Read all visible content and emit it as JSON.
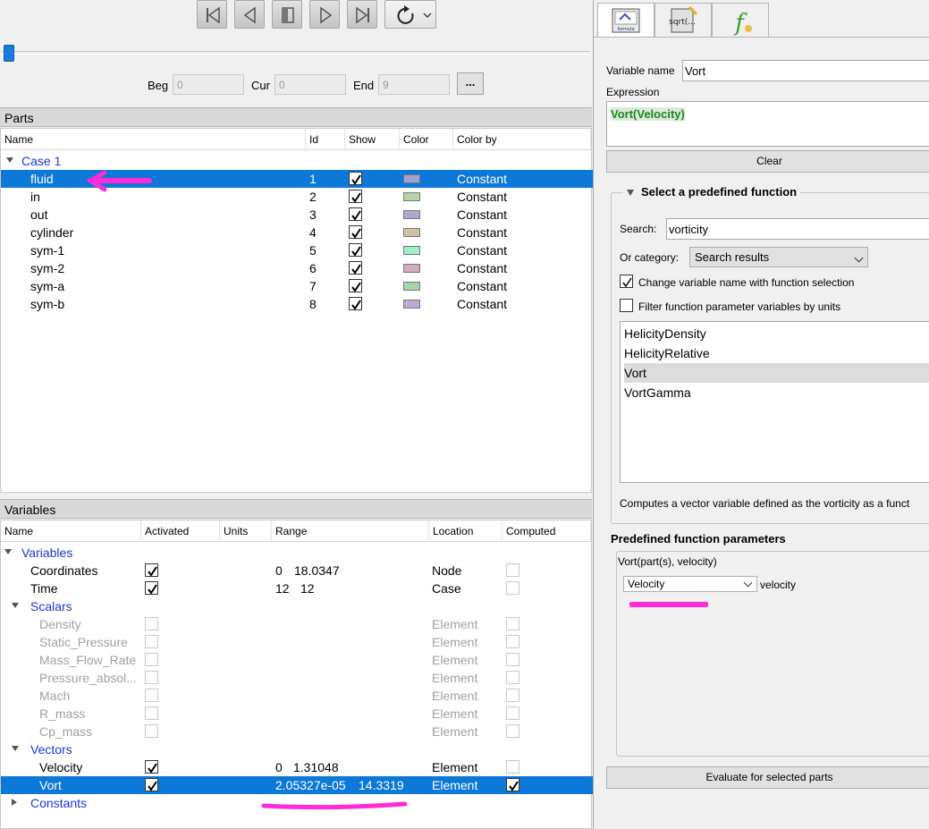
{
  "toolbar": {
    "buttons": [
      {
        "icon": "skip-to-start-icon"
      },
      {
        "icon": "step-back-icon"
      },
      {
        "icon": "stop-icon"
      },
      {
        "icon": "play-icon"
      },
      {
        "icon": "skip-to-end-icon"
      },
      {
        "icon": "loop-icon"
      }
    ],
    "beg_label": "Beg",
    "beg_value": "0",
    "cur_label": "Cur",
    "cur_value": "0",
    "end_label": "End",
    "end_value": "9",
    "more_label": "..."
  },
  "parts": {
    "title": "Parts",
    "columns": [
      "Name",
      "Id",
      "Show",
      "Color",
      "Color by"
    ],
    "case_label": "Case 1",
    "rows": [
      {
        "name": "fluid",
        "id": "1",
        "color": "#9ea2cc",
        "color_by": "Constant"
      },
      {
        "name": "in",
        "id": "2",
        "color": "#b8d2a8",
        "color_by": "Constant"
      },
      {
        "name": "out",
        "id": "3",
        "color": "#a9aace",
        "color_by": "Constant"
      },
      {
        "name": "cylinder",
        "id": "4",
        "color": "#cfc1a6",
        "color_by": "Constant"
      },
      {
        "name": "sym-1",
        "id": "5",
        "color": "#9cf0c4",
        "color_by": "Constant"
      },
      {
        "name": "sym-2",
        "id": "6",
        "color": "#d2acbe",
        "color_by": "Constant"
      },
      {
        "name": "sym-a",
        "id": "7",
        "color": "#a6d2ac",
        "color_by": "Constant"
      },
      {
        "name": "sym-b",
        "id": "8",
        "color": "#bcaad2",
        "color_by": "Constant"
      }
    ]
  },
  "variables": {
    "title": "Variables",
    "columns": [
      "Name",
      "Activated",
      "Units",
      "Range",
      "Location",
      "Computed"
    ],
    "group_variables": "Variables",
    "coordinates": {
      "name": "Coordinates",
      "range_min": "0",
      "range_max": "18.0347",
      "location": "Node"
    },
    "time": {
      "name": "Time",
      "range_min": "12",
      "range_max": "12",
      "location": "Case"
    },
    "group_scalars": "Scalars",
    "scalars": [
      {
        "name": "Density",
        "location": "Element"
      },
      {
        "name": "Static_Pressure",
        "location": "Element"
      },
      {
        "name": "Mass_Flow_Rate",
        "location": "Element"
      },
      {
        "name": "Pressure_absol...",
        "location": "Element"
      },
      {
        "name": "Mach",
        "location": "Element"
      },
      {
        "name": "R_mass",
        "location": "Element"
      },
      {
        "name": "Cp_mass",
        "location": "Element"
      }
    ],
    "group_vectors": "Vectors",
    "velocity": {
      "name": "Velocity",
      "range_min": "0",
      "range_max": "1.31048",
      "location": "Element"
    },
    "vort": {
      "name": "Vort",
      "range_min": "2.05327e-05",
      "range_max": "14.3319",
      "location": "Element"
    },
    "group_constants": "Constants"
  },
  "calculator": {
    "tabs": [
      {
        "icon": "general-formula-icon",
        "caption": "formula"
      },
      {
        "icon": "math-function-icon",
        "caption": "sqrt(..."
      },
      {
        "icon": "user-function-icon",
        "caption": "f"
      }
    ],
    "varname_label": "Variable name",
    "varname_value": "Vort",
    "expression_label": "Expression",
    "expression_value": "Vort(Velocity)",
    "clear_label": "Clear",
    "predef_title": "Select a predefined function",
    "search_label": "Search:",
    "search_value": "vorticity",
    "category_label": "Or category:",
    "category_value": "Search results",
    "change_name_label": "Change variable name with function selection",
    "filter_label": "Filter function parameter variables by units",
    "functions": [
      "HelicityDensity",
      "HelicityRelative",
      "Vort",
      "VortGamma"
    ],
    "selected_function": "Vort",
    "description": "Computes a vector variable defined as the vorticity as a funct",
    "params_title": "Predefined function parameters",
    "signature": "Vort(part(s), velocity)",
    "param_value": "Velocity",
    "param_label": "velocity",
    "evaluate_label": "Evaluate for selected parts"
  },
  "colors": {
    "selection": "#0c78d7",
    "annotation": "#ff2bd6",
    "expression_text": "#1a8a1a",
    "link_text": "#1e37d2"
  }
}
